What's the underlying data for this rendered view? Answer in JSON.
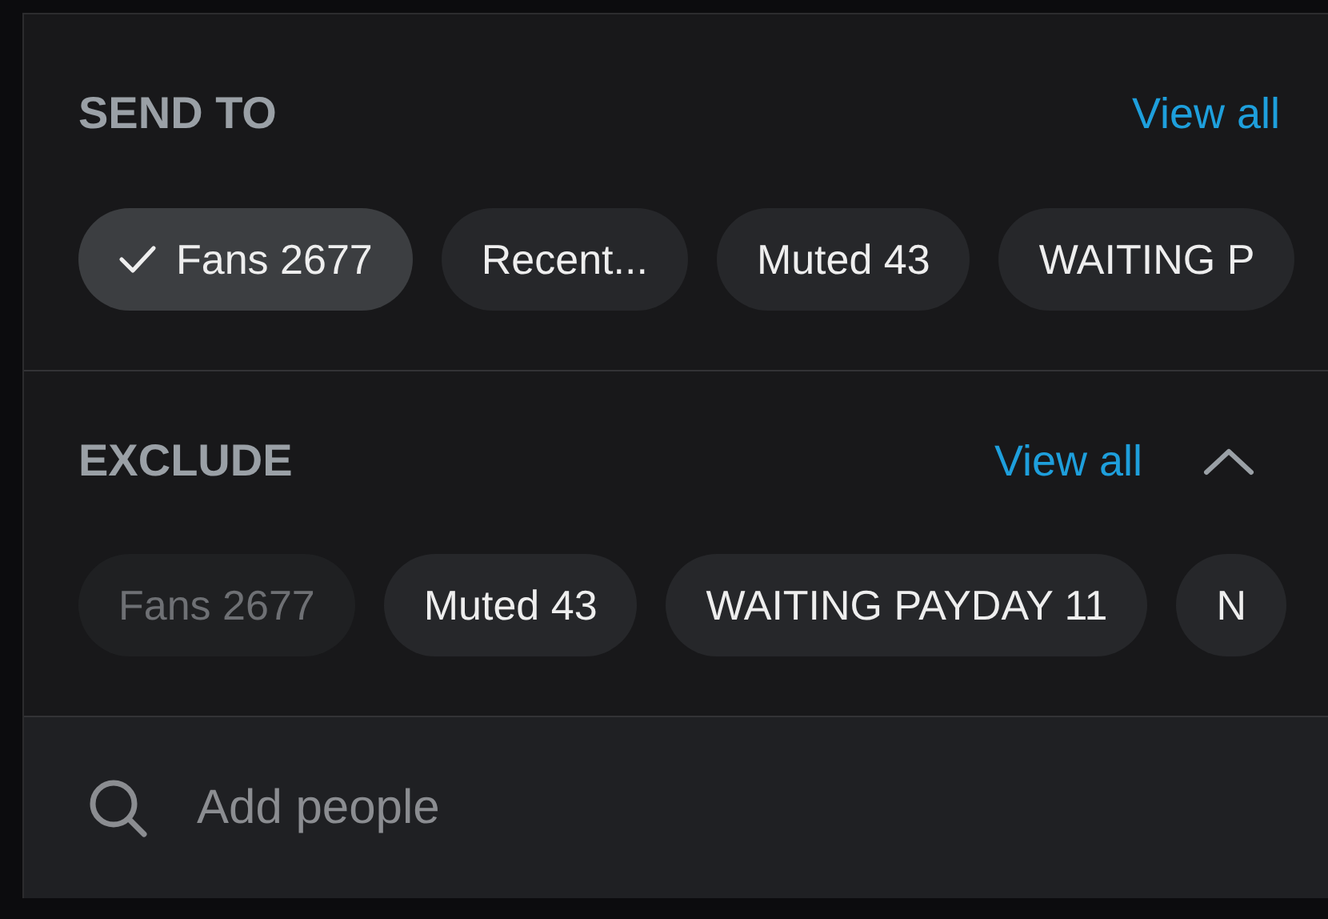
{
  "send_to": {
    "title": "SEND TO",
    "view_all": "View all",
    "chips": [
      {
        "label": "Fans 2677",
        "selected": true,
        "disabled": false
      },
      {
        "label": "Recent...",
        "selected": false,
        "disabled": false
      },
      {
        "label": "Muted 43",
        "selected": false,
        "disabled": false
      },
      {
        "label": "WAITING P",
        "selected": false,
        "disabled": false
      }
    ]
  },
  "exclude": {
    "title": "EXCLUDE",
    "view_all": "View all",
    "expanded": true,
    "chips": [
      {
        "label": "Fans 2677",
        "selected": false,
        "disabled": true
      },
      {
        "label": "Muted 43",
        "selected": false,
        "disabled": false
      },
      {
        "label": "WAITING PAYDAY 11",
        "selected": false,
        "disabled": false
      },
      {
        "label": "N",
        "selected": false,
        "disabled": false
      }
    ]
  },
  "search": {
    "placeholder": "Add people"
  }
}
